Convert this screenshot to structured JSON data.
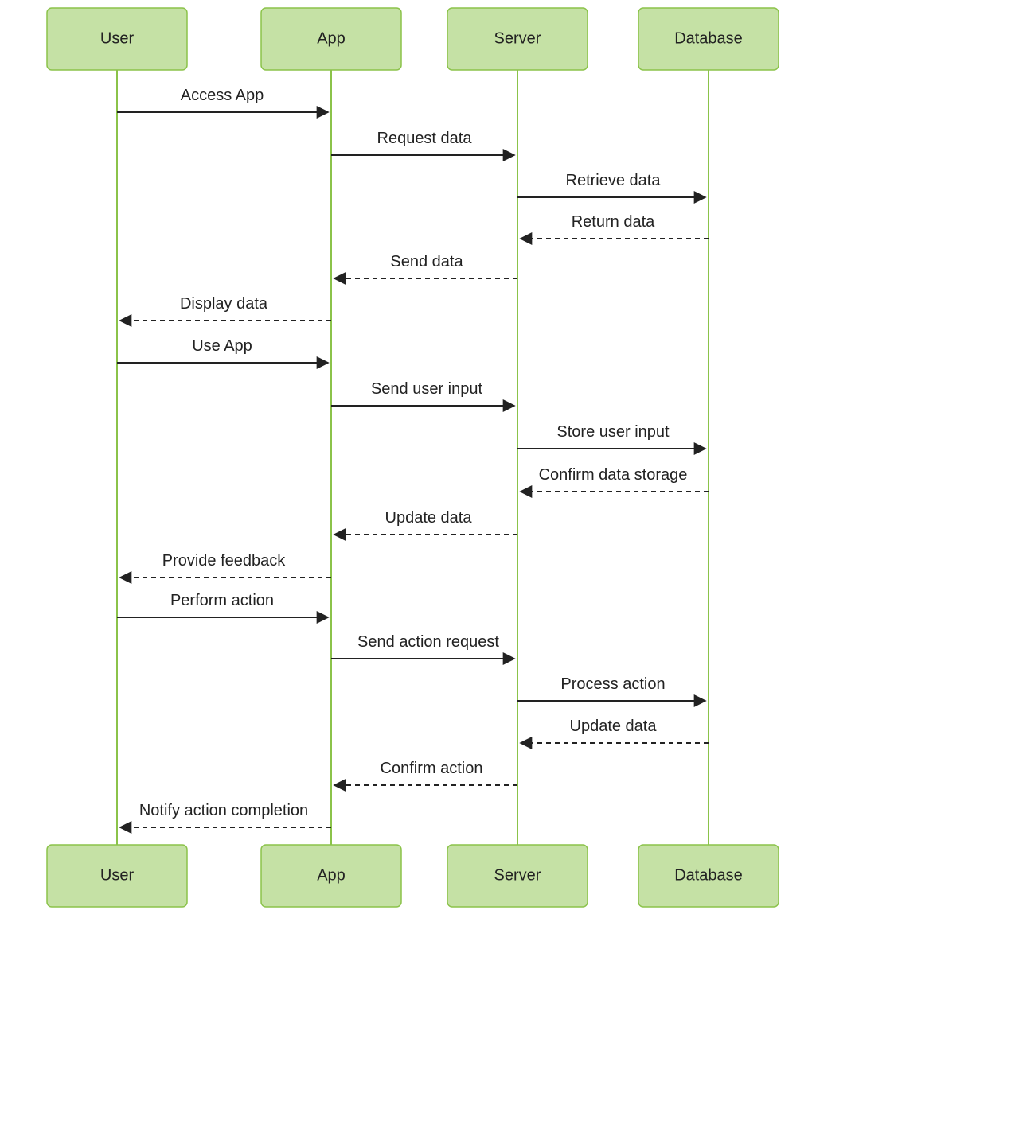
{
  "actors": {
    "user": "User",
    "app": "App",
    "server": "Server",
    "database": "Database"
  },
  "messages": {
    "m1": "Access App",
    "m2": "Request data",
    "m3": "Retrieve data",
    "m4": "Return data",
    "m5": "Send data",
    "m6": "Display data",
    "m7": "Use App",
    "m8": "Send user input",
    "m9": "Store user input",
    "m10": "Confirm data storage",
    "m11": "Update data",
    "m12": "Provide feedback",
    "m13": "Perform action",
    "m14": "Send action request",
    "m15": "Process action",
    "m16": "Update data",
    "m17": "Confirm action",
    "m18": "Notify action completion"
  }
}
